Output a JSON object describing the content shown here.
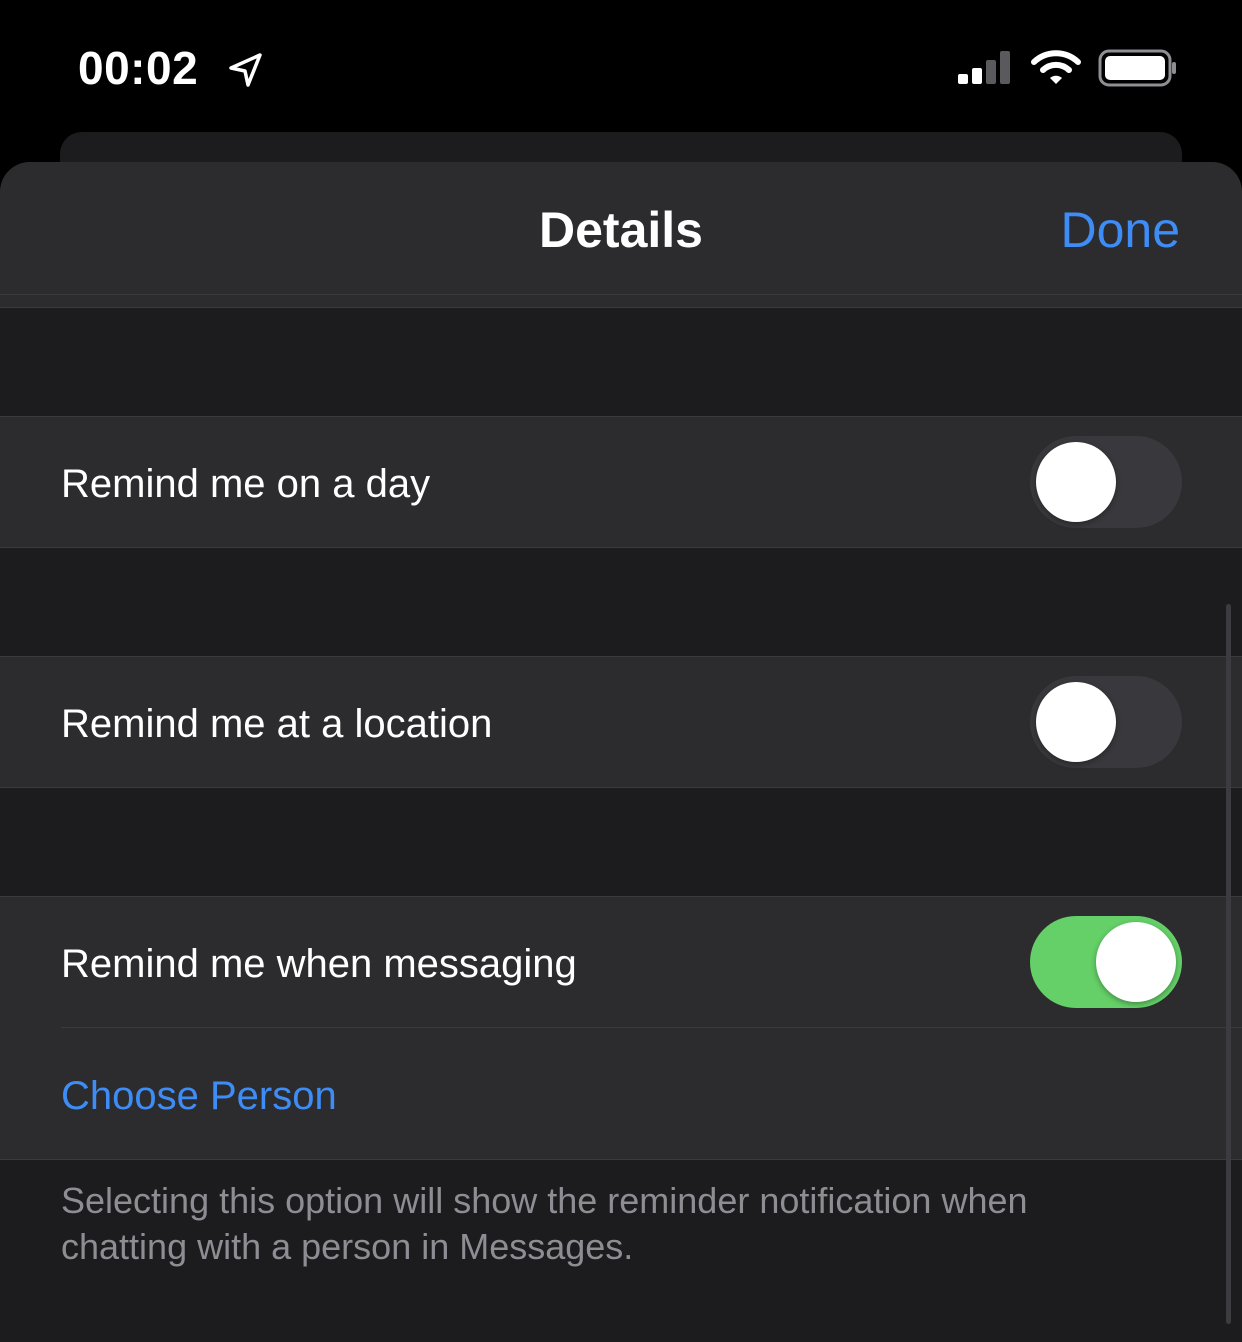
{
  "status_bar": {
    "time": "00:02",
    "icons": [
      "location-arrow-icon",
      "cellular-signal-icon",
      "wifi-icon",
      "battery-icon"
    ]
  },
  "nav": {
    "title": "Details",
    "done_label": "Done"
  },
  "rows": {
    "remind_day": {
      "label": "Remind me on a day",
      "enabled": false
    },
    "remind_location": {
      "label": "Remind me at a location",
      "enabled": false
    },
    "remind_messaging": {
      "label": "Remind me when messaging",
      "enabled": true
    },
    "choose_person": "Choose Person"
  },
  "footer_note": "Selecting this option will show the reminder notification when chatting with a person in Messages.",
  "colors": {
    "accent": "#3e8cf5",
    "toggle_on": "#65d068",
    "toggle_off": "#39393d",
    "cell_background": "#2c2c2e",
    "grouped_background": "#1c1c1e"
  }
}
